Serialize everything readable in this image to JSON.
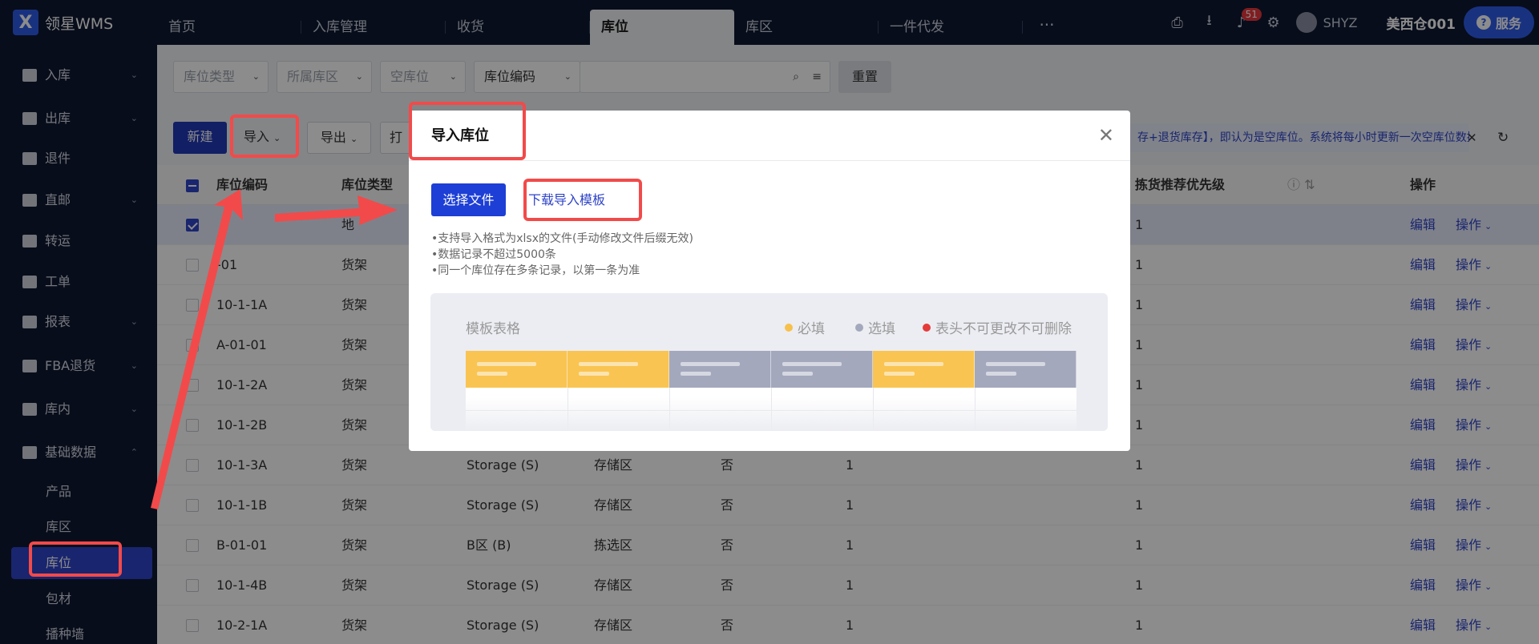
{
  "app": {
    "title": "领星WMS",
    "logo_letter": "X"
  },
  "tabs": [
    "首页",
    "入库管理",
    "收货",
    "库位",
    "库区",
    "一件代发"
  ],
  "tabs_more": "···",
  "header": {
    "notification_count": "51",
    "user": "SHYZ",
    "warehouse": "美西仓001",
    "service": "服务"
  },
  "sidebar": {
    "items": [
      {
        "label": "入库",
        "caret": "⌄"
      },
      {
        "label": "出库",
        "caret": "⌄"
      },
      {
        "label": "退件",
        "caret": ""
      },
      {
        "label": "直邮",
        "caret": "⌄"
      },
      {
        "label": "转运",
        "caret": ""
      },
      {
        "label": "工单",
        "caret": ""
      },
      {
        "label": "报表",
        "caret": "⌄"
      },
      {
        "label": "FBA退货",
        "caret": "⌄"
      },
      {
        "label": "库内",
        "caret": "⌄"
      },
      {
        "label": "基础数据",
        "caret": "⌃"
      }
    ],
    "sub_items": [
      "产品",
      "库区",
      "库位",
      "包材",
      "播种墙"
    ]
  },
  "filters": {
    "location_type": "库位类型",
    "zone": "所属库区",
    "empty": "空库位",
    "code_select": "库位编码",
    "reset": "重置"
  },
  "toolbar": {
    "new": "新建",
    "import": "导入",
    "export": "导出",
    "print": "打"
  },
  "notice": "存+退货库存】，即认为是空库位。系统将每小时更新一次空库位数据",
  "table": {
    "headers": [
      "库位编码",
      "库位类型",
      "拣货推荐优先级",
      "操作"
    ],
    "edit": "编辑",
    "op": "操作",
    "rows": [
      {
        "code": "",
        "type": "地",
        "zone": "",
        "area": "",
        "empty": "",
        "prio": "",
        "pick": "1"
      },
      {
        "code": "-01",
        "type": "货架",
        "zone": "",
        "area": "",
        "empty": "",
        "prio": "",
        "pick": "1"
      },
      {
        "code": "10-1-1A",
        "type": "货架",
        "zone": "",
        "area": "",
        "empty": "",
        "prio": "",
        "pick": "1"
      },
      {
        "code": "A-01-01",
        "type": "货架",
        "zone": "",
        "area": "",
        "empty": "",
        "prio": "",
        "pick": "1"
      },
      {
        "code": "10-1-2A",
        "type": "货架",
        "zone": "",
        "area": "",
        "empty": "",
        "prio": "",
        "pick": "1"
      },
      {
        "code": "10-1-2B",
        "type": "货架",
        "zone": "",
        "area": "",
        "empty": "",
        "prio": "",
        "pick": "1"
      },
      {
        "code": "10-1-3A",
        "type": "货架",
        "zone": "Storage (S)",
        "area": "存储区",
        "empty": "否",
        "prio": "1",
        "pick": "1"
      },
      {
        "code": "10-1-1B",
        "type": "货架",
        "zone": "Storage (S)",
        "area": "存储区",
        "empty": "否",
        "prio": "1",
        "pick": "1"
      },
      {
        "code": "B-01-01",
        "type": "货架",
        "zone": "B区 (B)",
        "area": "拣选区",
        "empty": "否",
        "prio": "1",
        "pick": "1"
      },
      {
        "code": "10-1-4B",
        "type": "货架",
        "zone": "Storage (S)",
        "area": "存储区",
        "empty": "否",
        "prio": "1",
        "pick": "1"
      },
      {
        "code": "10-2-1A",
        "type": "货架",
        "zone": "Storage (S)",
        "area": "存储区",
        "empty": "否",
        "prio": "1",
        "pick": "1"
      }
    ]
  },
  "modal": {
    "title": "导入库位",
    "choose_file": "选择文件",
    "download_template": "下载导入模板",
    "tips": [
      "•支持导入格式为xlsx的文件(手动修改文件后缀无效)",
      "•数据记录不超过5000条",
      "•同一个库位存在多条记录，以第一条为准"
    ],
    "template_title": "模板表格",
    "legend": [
      {
        "label": "必填",
        "color": "#f7c04a"
      },
      {
        "label": "选填",
        "color": "#a3a8bd"
      },
      {
        "label": "表头不可更改不可删除",
        "color": "#e53a3a"
      }
    ],
    "columns": [
      "#f9c451",
      "#f9c451",
      "#a3a8bd",
      "#a3a8bd",
      "#f9c451",
      "#a3a8bd"
    ]
  },
  "colors": {
    "annotation": "#f24a4a",
    "primary": "#2239b8",
    "sidebar_bg": "#101832"
  }
}
